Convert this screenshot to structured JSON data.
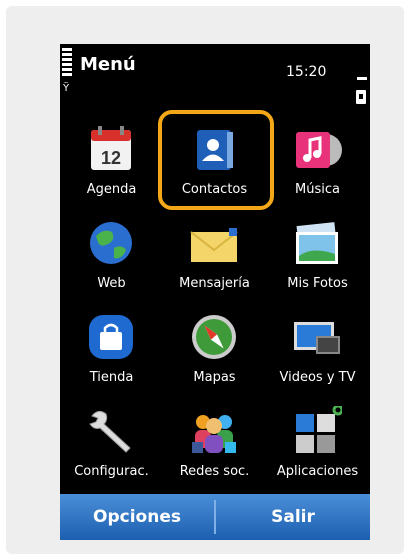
{
  "status": {
    "title": "Menú",
    "time": "15:20"
  },
  "grid": [
    {
      "label": "Agenda",
      "icon": "calendar-icon",
      "day": "12"
    },
    {
      "label": "Contactos",
      "icon": "contacts-icon"
    },
    {
      "label": "Música",
      "icon": "music-icon"
    },
    {
      "label": "Web",
      "icon": "globe-icon"
    },
    {
      "label": "Mensajería",
      "icon": "envelope-icon"
    },
    {
      "label": "Mis Fotos",
      "icon": "photos-icon"
    },
    {
      "label": "Tienda",
      "icon": "store-bag-icon"
    },
    {
      "label": "Mapas",
      "icon": "compass-icon"
    },
    {
      "label": "Videos y TV",
      "icon": "tv-icon"
    },
    {
      "label": "Configurac.",
      "icon": "wrench-icon"
    },
    {
      "label": "Redes soc.",
      "icon": "social-network-icon"
    },
    {
      "label": "Aplicaciones",
      "icon": "apps-icon"
    }
  ],
  "selected": "Contactos",
  "softkeys": {
    "left": "Opciones",
    "right": "Salir"
  },
  "colors": {
    "selection": "#f4a818",
    "softkey_top": "#4a8fd8",
    "softkey_bottom": "#1d5fb0",
    "background": "#000000"
  }
}
